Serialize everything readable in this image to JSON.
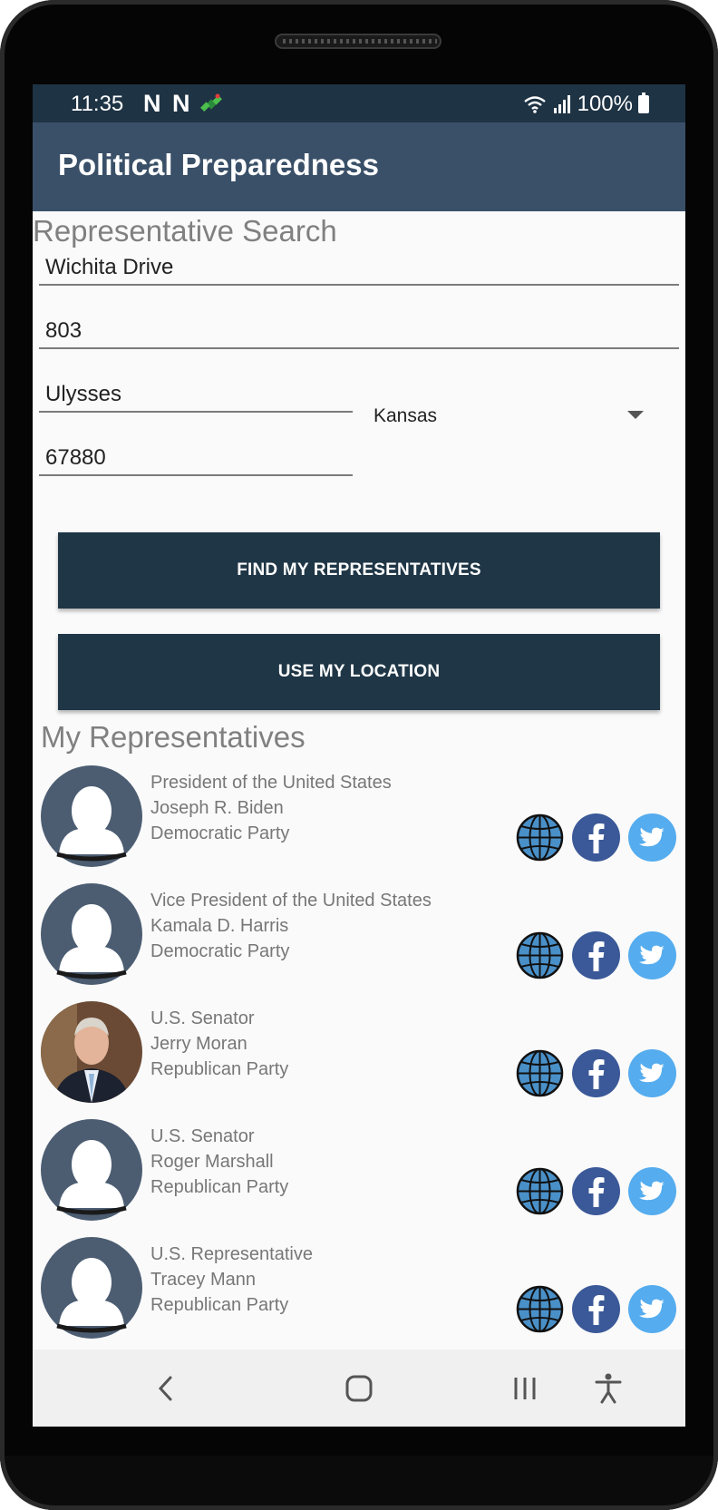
{
  "status_bar": {
    "time": "11:35",
    "notif_1": "N",
    "notif_2": "N",
    "notif_3_icon": "satellite-icon",
    "wifi_icon": "wifi-icon",
    "signal_icon": "signal-icon",
    "battery": "100%"
  },
  "app_bar": {
    "title": "Political Preparedness"
  },
  "search": {
    "title": "Representative Search",
    "address_line_1": "Wichita Drive",
    "address_line_2": "803",
    "city": "Ulysses",
    "state": "Kansas",
    "zip": "67880",
    "find_button": "FIND MY REPRESENTATIVES",
    "location_button": "USE MY LOCATION"
  },
  "representatives": {
    "title": "My Representatives",
    "items": [
      {
        "office": "President of the United States",
        "name": "Joseph R. Biden",
        "party": "Democratic Party",
        "photo": "placeholder"
      },
      {
        "office": "Vice President of the United States",
        "name": "Kamala D. Harris",
        "party": "Democratic Party",
        "photo": "placeholder"
      },
      {
        "office": "U.S. Senator",
        "name": "Jerry Moran",
        "party": "Republican Party",
        "photo": "portrait"
      },
      {
        "office": "U.S. Senator",
        "name": "Roger Marshall",
        "party": "Republican Party",
        "photo": "placeholder"
      },
      {
        "office": "U.S. Representative",
        "name": "Tracey Mann",
        "party": "Republican Party",
        "photo": "placeholder"
      }
    ]
  },
  "icons": {
    "web": "globe-icon",
    "facebook": "facebook-icon",
    "twitter": "twitter-icon"
  },
  "colors": {
    "status_bar": "#1e3344",
    "app_bar": "#3a5068",
    "button": "#1f3646",
    "facebook": "#3b5998",
    "twitter": "#55acee",
    "globe": "#4a90c8"
  },
  "nav": {
    "back_icon": "back-icon",
    "home_icon": "home-icon",
    "recents_icon": "recents-icon",
    "accessibility_icon": "accessibility-icon"
  }
}
